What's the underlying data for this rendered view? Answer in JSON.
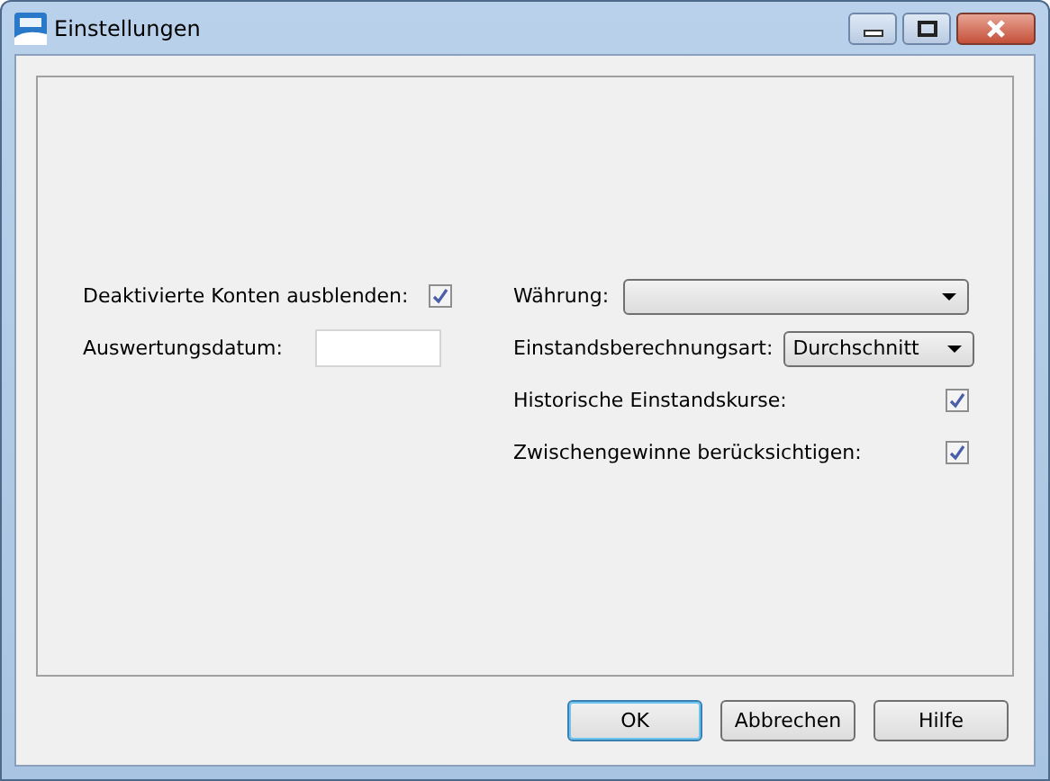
{
  "window": {
    "title": "Einstellungen"
  },
  "left_fields": [
    {
      "kind": "checkbox",
      "label": "Deaktivierte Konten ausblenden:",
      "checked": true
    },
    {
      "kind": "input",
      "label": "Auswertungsdatum:"
    }
  ],
  "right_fields": [
    {
      "kind": "dropdown",
      "label": "Währung:"
    },
    {
      "kind": "dropdown",
      "label": "Einstandsberechnungsart:",
      "value": "Durchschnitt"
    },
    {
      "kind": "checkbox",
      "label": "Historische Einstandskurse:",
      "checked": true
    },
    {
      "kind": "checkbox",
      "label": "Zwischengewinne berücksichtigen:",
      "checked": true
    }
  ],
  "buttons": [
    {
      "label": "OK",
      "default": true
    },
    {
      "label": "Abbrechen",
      "default": false
    },
    {
      "label": "Hilfe",
      "default": false
    }
  ]
}
